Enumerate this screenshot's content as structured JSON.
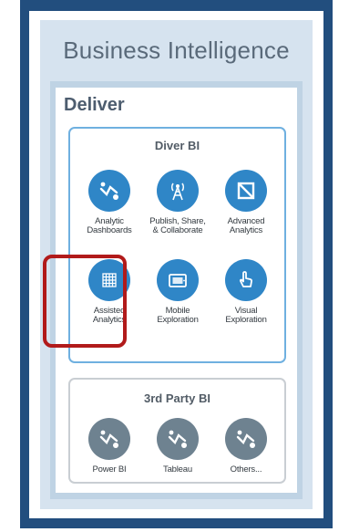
{
  "header": {
    "title": "Business Intelligence"
  },
  "deliver": {
    "title": "Deliver",
    "diver": {
      "title": "Diver BI",
      "items": [
        {
          "label": "Analytic\nDashboards",
          "icon": "dashboard-icon"
        },
        {
          "label": "Publish, Share,\n& Collaborate",
          "icon": "broadcast-icon"
        },
        {
          "label": "Advanced\nAnalytics",
          "icon": "advanced-analytics-icon"
        },
        {
          "label": "Assisted\nAnalytics",
          "icon": "grid-icon"
        },
        {
          "label": "Mobile\nExploration",
          "icon": "tablet-icon"
        },
        {
          "label": "Visual\nExploration",
          "icon": "pointer-hand-icon"
        }
      ]
    },
    "third_party": {
      "title": "3rd Party BI",
      "items": [
        {
          "label": "Power BI",
          "icon": "dashboard-icon"
        },
        {
          "label": "Tableau",
          "icon": "dashboard-icon"
        },
        {
          "label": "Others...",
          "icon": "dashboard-icon"
        }
      ]
    }
  },
  "colors": {
    "frame": "#224e7e",
    "icon_blue": "#2f86c7",
    "icon_gray": "#6e8290",
    "highlight": "#b11a1a"
  }
}
